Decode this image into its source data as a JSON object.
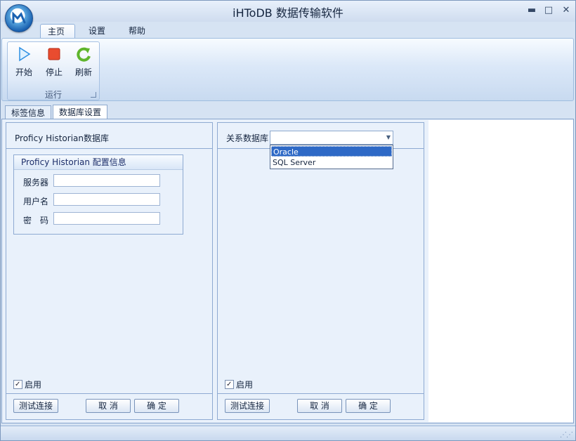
{
  "window": {
    "title": "iHToDB 数据传输软件",
    "controls": [
      "minimize",
      "maximize",
      "close"
    ]
  },
  "ribbon": {
    "tabs": [
      "主页",
      "设置",
      "帮助"
    ],
    "group": {
      "label": "运行",
      "buttons": [
        "开始",
        "停止",
        "刷新"
      ]
    }
  },
  "document_tabs": [
    "标签信息",
    "数据库设置"
  ],
  "left_panel": {
    "title": "Proficy Historian数据库",
    "config": {
      "title": "Proficy Historian 配置信息",
      "fields": [
        {
          "label": "服务器",
          "value": ""
        },
        {
          "label": "用户名",
          "value": ""
        },
        {
          "label": "密　码",
          "value": ""
        }
      ]
    },
    "enable_label": "启用",
    "buttons": {
      "test": "测试连接",
      "cancel": "取 消",
      "ok": "确 定"
    }
  },
  "right_panel": {
    "select_label": "关系数据库",
    "selected_value": "",
    "options": [
      "Oracle",
      "SQL Server"
    ],
    "highlighted_option": "Oracle",
    "enable_label": "启用",
    "buttons": {
      "test": "测试连接",
      "cancel": "取 消",
      "ok": "确 定"
    }
  }
}
